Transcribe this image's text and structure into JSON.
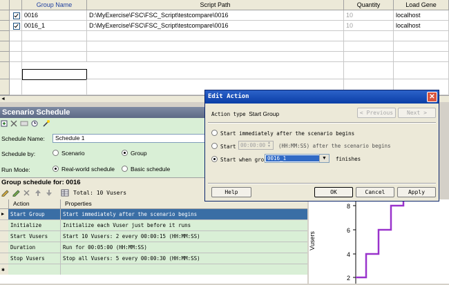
{
  "grid": {
    "headers": [
      "Group Name",
      "Script Path",
      "Quantity",
      "Load Gene"
    ],
    "rows": [
      {
        "name": "0016",
        "path": "D:\\MyExercise\\FSC\\FSC_Script\\testcompare\\0016",
        "qty": "10",
        "lg": "localhost"
      },
      {
        "name": "0016_1",
        "path": "D:\\MyExercise\\FSC\\FSC_Script\\testcompare\\0016",
        "qty": "10",
        "lg": "localhost"
      }
    ]
  },
  "schedule": {
    "title": "Scenario Schedule",
    "name_label": "Schedule Name:",
    "name_value": "Schedule 1",
    "by_label": "Schedule by:",
    "by_options": [
      "Scenario",
      "Group"
    ],
    "mode_label": "Run Mode:",
    "mode_options": [
      "Real-world schedule",
      "Basic schedule"
    ]
  },
  "group": {
    "title": "Group schedule for: 0016",
    "total": "Total: 10 Vusers",
    "col_action": "Action",
    "col_props": "Properties",
    "actions": [
      {
        "action": "Start Group",
        "props": "Start immediately after the scenario begins"
      },
      {
        "action": "Initialize",
        "props": "Initialize each Vuser just before it runs"
      },
      {
        "action": "Start  Vusers",
        "props": "Start 10 Vusers: 2 every 00:00:15 (HH:MM:SS)"
      },
      {
        "action": "Duration",
        "props": "Run for 00:05:00 (HH:MM:SS)"
      },
      {
        "action": "Stop Vusers",
        "props": "Stop all Vusers: 5 every 00:00:30 (HH:MM:SS)"
      }
    ]
  },
  "chart": {
    "ylabel": "Vusers",
    "ticks": [
      "8",
      "6",
      "4",
      "2"
    ],
    "line_color": "#9933cc"
  },
  "dialog": {
    "title": "Edit Action",
    "action_type_label": "Action type",
    "action_type_value": "Start Group",
    "prev": "< Previous",
    "next": "Next >",
    "opt1": "Start immediately after the scenario begins",
    "opt2": "Start",
    "opt2_time": "00:00:00",
    "opt2_suffix": "(HH:MM:SS) after the scenario begins",
    "opt3": "Start when gro",
    "opt3_group": "0016_1",
    "opt3_suffix": "finishes",
    "help": "Help",
    "ok": "OK",
    "cancel": "Cancel",
    "apply": "Apply"
  }
}
